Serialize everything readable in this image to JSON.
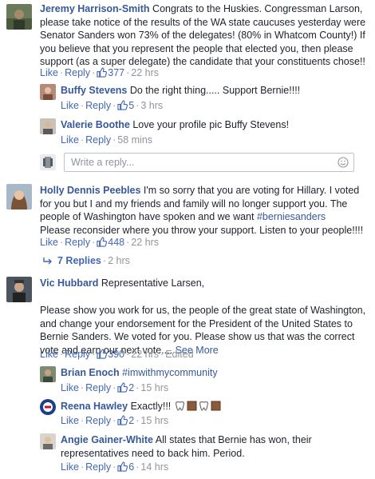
{
  "comments": [
    {
      "author": "Jeremy Harrison-Smith",
      "text": "Congrats to the Huskies. Congressman Larson, please take notice of the results of the WA state caucuses yesterday were Senator Sanders won 73% of the delegates! (80% in Whatcom County!) If you believe that you represent the people that elected you, then please support (as a super delegate) the candidate that your constituents chose!!",
      "like": "Like",
      "reply": "Reply",
      "likes": "377",
      "time": "22 hrs"
    },
    {
      "author": "Buffy Stevens",
      "text": "Do the right thing..... Support Bernie!!!!",
      "like": "Like",
      "reply": "Reply",
      "likes": "5",
      "time": "3 hrs"
    },
    {
      "author": "Valerie Boothe",
      "text": "Love your profile pic Buffy Stevens!",
      "like": "Like",
      "reply": "Reply",
      "time": "58 mins"
    },
    {
      "author": "Holly Dennis Peebles",
      "text": "I'm so sorry that you are voting for Hillary. I voted for you but I and my friends and family will no longer support you. The people of Washington have spoken and we want ",
      "hashtag": "#berniesanders",
      "text2": "Please reconsider where you throw your support. Listen to your people!!!!",
      "like": "Like",
      "reply": "Reply",
      "likes": "448",
      "time": "22 hrs"
    },
    {
      "author": "Vic Hubbard",
      "text": "Representative Larsen,",
      "text2": "Please show you work for us, the people of the great state of Washington, and change your endorsement for the President of the United States to Bernie Sanders. We voted for you. Please show us that was the correct vote and earn our next vote....",
      "see_more": "See More",
      "like": "Like",
      "reply": "Reply",
      "likes": "390",
      "time": "22 hrs",
      "edited": "Edited"
    },
    {
      "author": "Brian Enoch",
      "hashtag": "#imwithmycommunity",
      "like": "Like",
      "reply": "Reply",
      "likes": "2",
      "time": "15 hrs"
    },
    {
      "author": "Reena Hawley",
      "text": "Exactly!!!",
      "like": "Like",
      "reply": "Reply",
      "likes": "2",
      "time": "15 hrs"
    },
    {
      "author": "Angie Gainer-White",
      "text": "All states that Bernie has won, their representatives need to back him. Period.",
      "like": "Like",
      "reply": "Reply",
      "likes": "6",
      "time": "14 hrs"
    }
  ],
  "reply_box": {
    "placeholder": "Write a reply..."
  },
  "view_replies": {
    "label": "7 Replies",
    "time": "2 hrs"
  },
  "colors": {
    "link": "#365899",
    "action": "#4267b2",
    "meta": "#90949c",
    "text": "#1d2129"
  }
}
